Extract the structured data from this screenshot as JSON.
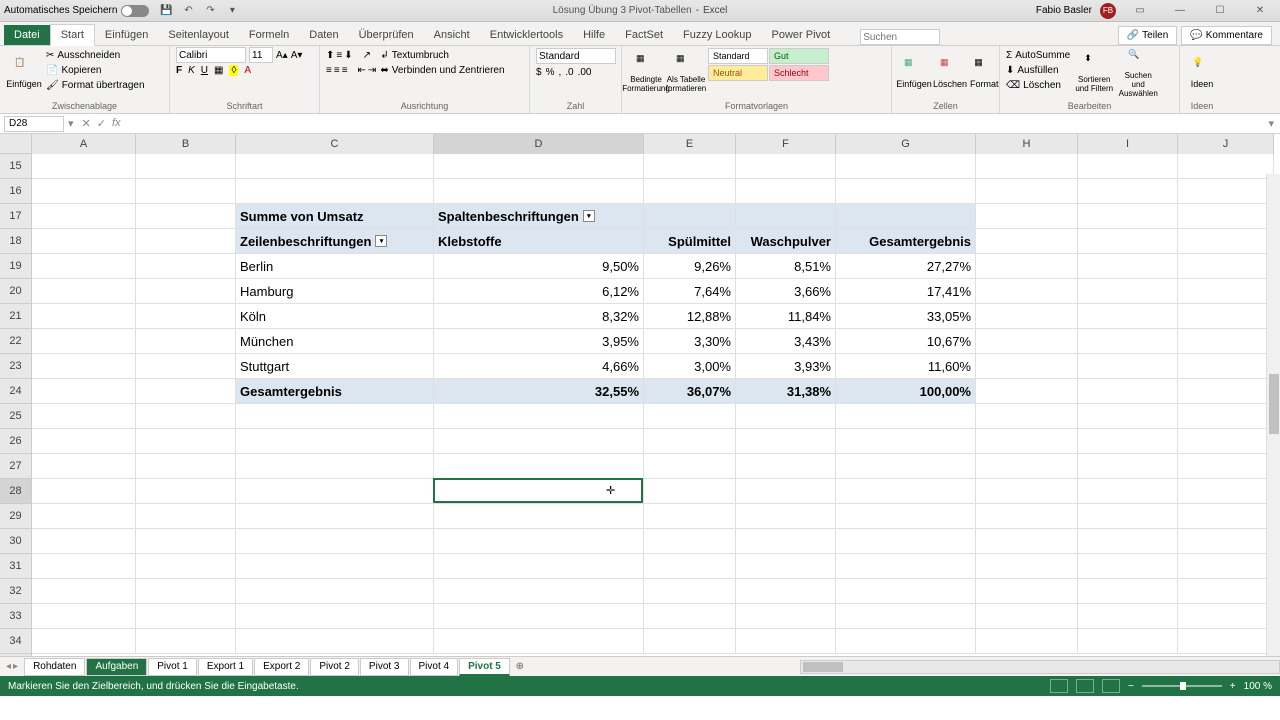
{
  "titlebar": {
    "autosave": "Automatisches Speichern",
    "filename": "Lösung Übung 3 Pivot-Tabellen",
    "app": "Excel",
    "user": "Fabio Basler",
    "initials": "FB"
  },
  "tabs": {
    "file": "Datei",
    "list": [
      "Start",
      "Einfügen",
      "Seitenlayout",
      "Formeln",
      "Daten",
      "Überprüfen",
      "Ansicht",
      "Entwicklertools",
      "Hilfe",
      "FactSet",
      "Fuzzy Lookup",
      "Power Pivot"
    ],
    "search_placeholder": "Suchen",
    "teilen": "Teilen",
    "kommentare": "Kommentare"
  },
  "ribbon": {
    "clipboard": {
      "paste": "Einfügen",
      "cut": "Ausschneiden",
      "copy": "Kopieren",
      "format_painter": "Format übertragen",
      "label": "Zwischenablage"
    },
    "font": {
      "name": "Calibri",
      "size": "11",
      "label": "Schriftart"
    },
    "align": {
      "wrap": "Textumbruch",
      "merge": "Verbinden und Zentrieren",
      "label": "Ausrichtung"
    },
    "number": {
      "format": "Standard",
      "label": "Zahl"
    },
    "styles": {
      "cond": "Bedingte Formatierung",
      "table": "Als Tabelle formatieren",
      "standard": "Standard",
      "gut": "Gut",
      "neutral": "Neutral",
      "schlecht": "Schlecht",
      "label": "Formatvorlagen"
    },
    "cells": {
      "insert": "Einfügen",
      "delete": "Löschen",
      "format": "Format",
      "label": "Zellen"
    },
    "editing": {
      "sum": "AutoSumme",
      "fill": "Ausfüllen",
      "clear": "Löschen",
      "sort": "Sortieren und Filtern",
      "find": "Suchen und Auswählen",
      "label": "Bearbeiten"
    },
    "ideas": {
      "label": "Ideen"
    }
  },
  "namebox": "D28",
  "columns": [
    "A",
    "B",
    "C",
    "D",
    "E",
    "F",
    "G",
    "H",
    "I",
    "J"
  ],
  "rows_start": 15,
  "rows_end": 34,
  "pivot": {
    "values_label": "Summe von Umsatz",
    "col_label": "Spaltenbeschriftungen",
    "row_label": "Zeilenbeschriftungen",
    "col_headers": [
      "Klebstoffe",
      "Spülmittel",
      "Waschpulver",
      "Gesamtergebnis"
    ],
    "rows": [
      {
        "name": "Berlin",
        "v": [
          "9,50%",
          "9,26%",
          "8,51%",
          "27,27%"
        ]
      },
      {
        "name": "Hamburg",
        "v": [
          "6,12%",
          "7,64%",
          "3,66%",
          "17,41%"
        ]
      },
      {
        "name": "Köln",
        "v": [
          "8,32%",
          "12,88%",
          "11,84%",
          "33,05%"
        ]
      },
      {
        "name": "München",
        "v": [
          "3,95%",
          "3,30%",
          "3,43%",
          "10,67%"
        ]
      },
      {
        "name": "Stuttgart",
        "v": [
          "4,66%",
          "3,00%",
          "3,93%",
          "11,60%"
        ]
      }
    ],
    "total_label": "Gesamtergebnis",
    "totals": [
      "32,55%",
      "36,07%",
      "31,38%",
      "100,00%"
    ]
  },
  "chart_data": {
    "type": "table",
    "title": "Summe von Umsatz",
    "categories": [
      "Berlin",
      "Hamburg",
      "Köln",
      "München",
      "Stuttgart",
      "Gesamtergebnis"
    ],
    "series": [
      {
        "name": "Klebstoffe",
        "values": [
          9.5,
          6.12,
          8.32,
          3.95,
          4.66,
          32.55
        ]
      },
      {
        "name": "Spülmittel",
        "values": [
          9.26,
          7.64,
          12.88,
          3.3,
          3.0,
          36.07
        ]
      },
      {
        "name": "Waschpulver",
        "values": [
          8.51,
          3.66,
          11.84,
          3.43,
          3.93,
          31.38
        ]
      },
      {
        "name": "Gesamtergebnis",
        "values": [
          27.27,
          17.41,
          33.05,
          10.67,
          11.6,
          100.0
        ]
      }
    ],
    "unit": "percent"
  },
  "sheets": [
    "Rohdaten",
    "Aufgaben",
    "Pivot 1",
    "Export 1",
    "Export 2",
    "Pivot 2",
    "Pivot 3",
    "Pivot 4",
    "Pivot 5"
  ],
  "active_sheet": "Pivot 5",
  "dark_sheet": "Aufgaben",
  "status": "Markieren Sie den Zielbereich, und drücken Sie die Eingabetaste.",
  "zoom": "100 %"
}
